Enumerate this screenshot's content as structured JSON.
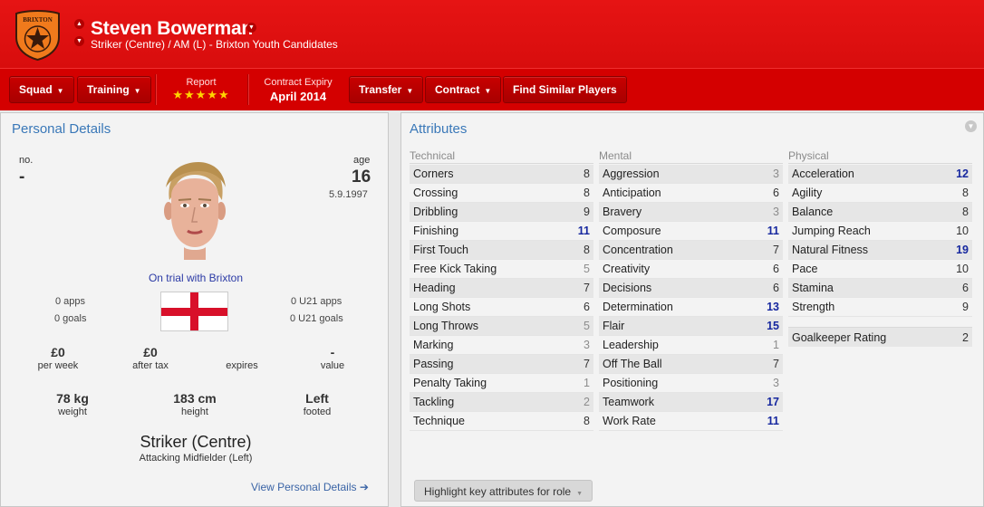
{
  "header": {
    "club_badge_text": "BRIXTON",
    "player_name": "Steven Bowerman",
    "subtitle": "Striker (Centre) / AM (L) - Brixton Youth Candidates"
  },
  "toolbar": {
    "squad": "Squad",
    "training": "Training",
    "report_label": "Report",
    "report_stars": "★★★★★",
    "contract_label": "Contract Expiry",
    "contract_value": "April 2014",
    "transfer": "Transfer",
    "contract": "Contract",
    "find_similar": "Find Similar Players"
  },
  "personal": {
    "title": "Personal Details",
    "no_label": "no.",
    "no_value": "-",
    "age_label": "age",
    "age_value": "16",
    "dob": "5.9.1997",
    "status": "On trial with Brixton",
    "apps": "0 apps",
    "goals": "0 goals",
    "u21_apps": "0 U21 apps",
    "u21_goals": "0 U21 goals",
    "wage_value": "£0",
    "wage_label": "per week",
    "after_tax_value": "£0",
    "after_tax_label": "after tax",
    "expires_value": "",
    "expires_label": "expires",
    "value_value": "-",
    "value_label": "value",
    "weight_value": "78 kg",
    "weight_label": "weight",
    "height_value": "183 cm",
    "height_label": "height",
    "foot_value": "Left",
    "foot_label": "footed",
    "position_main": "Striker (Centre)",
    "position_sub": "Attacking Midfielder (Left)",
    "view_link": "View Personal Details ➔"
  },
  "attributes": {
    "title": "Attributes",
    "technical_title": "Technical",
    "mental_title": "Mental",
    "physical_title": "Physical",
    "technical": [
      {
        "name": "Corners",
        "value": "8"
      },
      {
        "name": "Crossing",
        "value": "8"
      },
      {
        "name": "Dribbling",
        "value": "9"
      },
      {
        "name": "Finishing",
        "value": "11"
      },
      {
        "name": "First Touch",
        "value": "8"
      },
      {
        "name": "Free Kick Taking",
        "value": "5"
      },
      {
        "name": "Heading",
        "value": "7"
      },
      {
        "name": "Long Shots",
        "value": "6"
      },
      {
        "name": "Long Throws",
        "value": "5"
      },
      {
        "name": "Marking",
        "value": "3"
      },
      {
        "name": "Passing",
        "value": "7"
      },
      {
        "name": "Penalty Taking",
        "value": "1"
      },
      {
        "name": "Tackling",
        "value": "2"
      },
      {
        "name": "Technique",
        "value": "8"
      }
    ],
    "mental": [
      {
        "name": "Aggression",
        "value": "3"
      },
      {
        "name": "Anticipation",
        "value": "6"
      },
      {
        "name": "Bravery",
        "value": "3"
      },
      {
        "name": "Composure",
        "value": "11"
      },
      {
        "name": "Concentration",
        "value": "7"
      },
      {
        "name": "Creativity",
        "value": "6"
      },
      {
        "name": "Decisions",
        "value": "6"
      },
      {
        "name": "Determination",
        "value": "13"
      },
      {
        "name": "Flair",
        "value": "15"
      },
      {
        "name": "Leadership",
        "value": "1"
      },
      {
        "name": "Off The Ball",
        "value": "7"
      },
      {
        "name": "Positioning",
        "value": "3"
      },
      {
        "name": "Teamwork",
        "value": "17"
      },
      {
        "name": "Work Rate",
        "value": "11"
      }
    ],
    "physical": [
      {
        "name": "Acceleration",
        "value": "12"
      },
      {
        "name": "Agility",
        "value": "8"
      },
      {
        "name": "Balance",
        "value": "8"
      },
      {
        "name": "Jumping Reach",
        "value": "10"
      },
      {
        "name": "Natural Fitness",
        "value": "19"
      },
      {
        "name": "Pace",
        "value": "10"
      },
      {
        "name": "Stamina",
        "value": "6"
      },
      {
        "name": "Strength",
        "value": "9"
      }
    ],
    "gk_label": "Goalkeeper Rating",
    "gk_value": "2",
    "highlight_button": "Highlight key attributes for role"
  },
  "colors": {
    "header_red": "#e61414",
    "toolbar_red": "#d40000",
    "accent_blue": "#3a78b8",
    "high_value_blue": "#17289f",
    "star_yellow": "#ffd400"
  }
}
